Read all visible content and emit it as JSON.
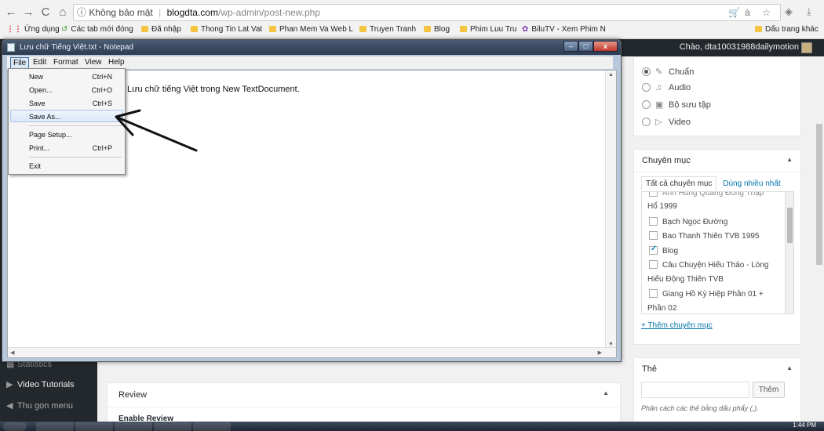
{
  "browser": {
    "back": "←",
    "forward": "→",
    "reload": "C",
    "home": "⌂",
    "info_icon": "ⓘ",
    "security_label": "Không bảo mật",
    "url_host": "blogdta.com",
    "url_path": "/wp-admin/post-new.php",
    "omnibox_icons": "à ☆",
    "bookmarks": [
      "Ứng dụng",
      "Các tab mới đóng",
      "Đã nhập",
      "Thong Tin Lat Vat",
      "Phan Mem Va Web L",
      "Truyen Tranh",
      "Blog",
      "Phim Luu Tru",
      "BiluTV - Xem Phim N",
      "Dấu trang khác"
    ]
  },
  "adminbar": {
    "greeting": "Chào, dta10031988dailymotion"
  },
  "wp_menu": {
    "statistics": "Statistics",
    "video_tutorials": "Video Tutorials",
    "collapse": "Thu gọn menu"
  },
  "post_format": {
    "options": [
      "Chuẩn",
      "Audio",
      "Bộ sưu tập",
      "Video"
    ],
    "selected": "Chuẩn"
  },
  "categories": {
    "title": "Chuyên mục",
    "tab_all": "Tất cả chuyên mục",
    "tab_popular": "Dùng nhiều nhất",
    "partial_first": "Anh Hùng Quảng Đông Thập",
    "items": [
      {
        "label": "Hổ 1999",
        "checkbox": false
      },
      {
        "label": "Bạch Ngọc Đường",
        "checkbox": true,
        "checked": false
      },
      {
        "label": "Bao Thanh Thiên TVB 1995",
        "checkbox": true,
        "checked": false
      },
      {
        "label": "Blog",
        "checkbox": true,
        "checked": true
      },
      {
        "label": "Câu Chuyện Hiếu Thảo - Lòng",
        "checkbox": true,
        "checked": false
      },
      {
        "label": "Hiếu Động Thiên TVB",
        "checkbox": false
      },
      {
        "label": "Giang Hồ Kỳ Hiệp Phần 01 +",
        "checkbox": true,
        "checked": false
      },
      {
        "label": "Phần 02",
        "checkbox": false
      }
    ],
    "add_link": "+ Thêm chuyên mục"
  },
  "tags": {
    "title": "Thẻ",
    "add_button": "Thêm",
    "hint": "Phân cách các thẻ bằng dấu phẩy (,)."
  },
  "review": {
    "title": "Review",
    "enable_label": "Enable Review"
  },
  "notepad": {
    "title": "Lưu chữ Tiếng Việt.txt - Notepad",
    "menus": [
      "File",
      "Edit",
      "Format",
      "View",
      "Help"
    ],
    "active_menu": "File",
    "content": "Lưu chữ tiếng Việt trong New TextDocument.",
    "file_menu": [
      {
        "label": "New",
        "shortcut": "Ctrl+N"
      },
      {
        "label": "Open...",
        "shortcut": "Ctrl+O"
      },
      {
        "label": "Save",
        "shortcut": "Ctrl+S"
      },
      {
        "label": "Save As...",
        "shortcut": ""
      },
      {
        "label": "Page Setup...",
        "shortcut": ""
      },
      {
        "label": "Print...",
        "shortcut": "Ctrl+P"
      },
      {
        "label": "Exit",
        "shortcut": ""
      }
    ],
    "highlighted_item": "Save As..."
  },
  "taskbar": {
    "clock": "1:44 PM"
  },
  "colors": {
    "wp_dark": "#23282d",
    "link": "#0073aa",
    "check": "#1e8cbe",
    "notepad_frame": "#b8c8dc"
  }
}
